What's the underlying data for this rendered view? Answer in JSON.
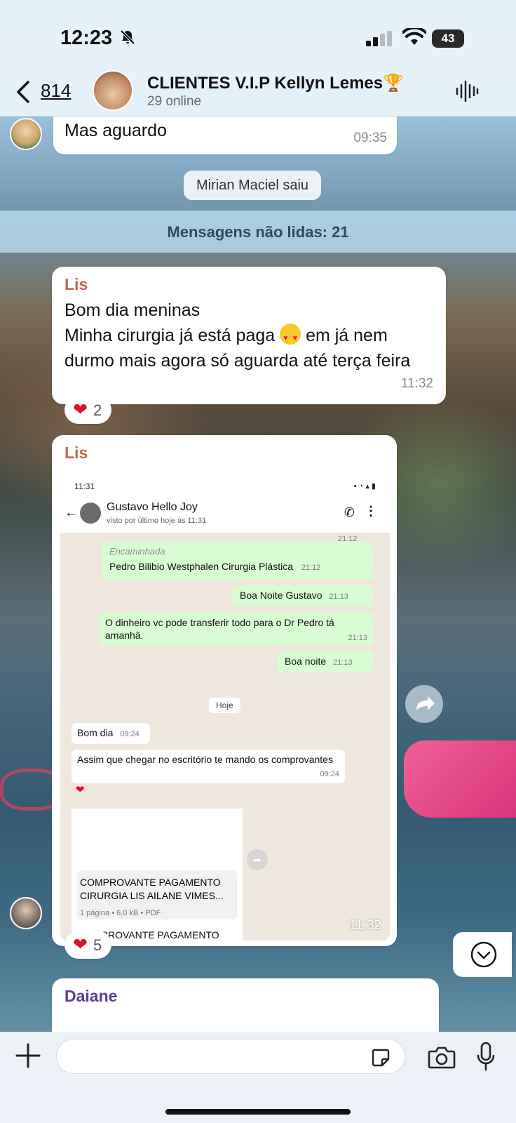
{
  "status_bar": {
    "time": "12:23",
    "battery": "43"
  },
  "header": {
    "back_count": "814",
    "title": "CLIENTES V.I.P Kellyn Lemes🏆",
    "subtitle": "29 online"
  },
  "messages": {
    "top": {
      "text": "Mas aguardo",
      "time": "09:35"
    },
    "system": "Mirian Maciel saiu",
    "unread": "Mensagens não lidas: 21",
    "lis1": {
      "sender": "Lis",
      "line1": "Bom dia meninas",
      "line2a": "Minha cirurgia já está paga",
      "line2b": "em já nem durmo mais agora só aguarda até terça feira",
      "time": "11:32",
      "reaction_count": "2"
    },
    "lis2": {
      "sender": "Lis",
      "time": "11:32",
      "reaction_count": "5"
    },
    "daiane": {
      "sender": "Daiane"
    }
  },
  "embedded": {
    "status_time": "11:31",
    "contact_name": "Gustavo Hello Joy",
    "contact_status": "visto por último hoje às 11:31",
    "top_time": "21:12",
    "forwarded_label": "Encaminhada",
    "msg1": {
      "text": "Pedro Bilibio Westphalen Cirurgia   Plástica",
      "time": "21:12"
    },
    "msg2": {
      "text": "Boa Noite Gustavo",
      "time": "21:13"
    },
    "msg3": {
      "text": "O dinheiro vc pode transferir todo para o Dr Pedro tá amanhã.",
      "time": "21:13"
    },
    "msg4": {
      "text": "Boa noite",
      "time": "21:13"
    },
    "day_label": "Hoje",
    "msg5": {
      "text": "Bom dia",
      "time": "09:24"
    },
    "msg6": {
      "text": "Assim que chegar no escritório te mando os comprovantes",
      "time": "09:24"
    },
    "doc": {
      "filename": "COMPROVANTE PAGAMENTO CIRURGIA LIS AILANE VIMES...",
      "meta": "1 página • 6,0 kB • PDF",
      "caption": "COMPROVANTE PAGAMENTO CIRURGIA LIS AILANE VIMES DA COSTA.pdf"
    }
  }
}
